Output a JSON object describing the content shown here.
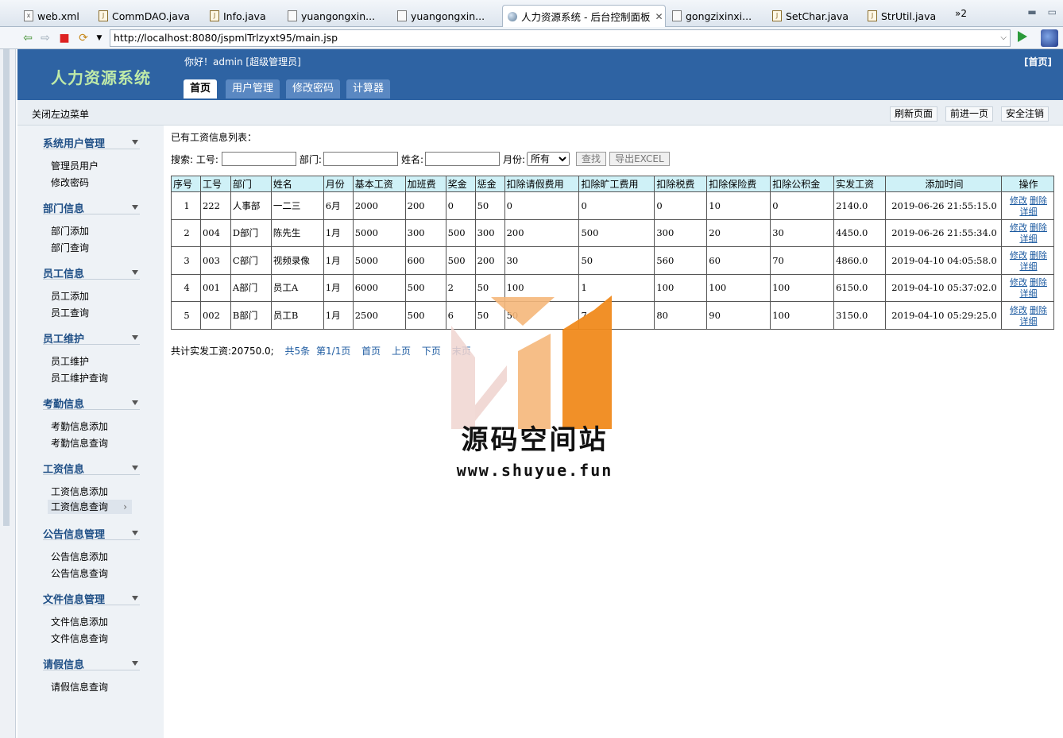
{
  "editor_tabs": [
    {
      "label": "web.xml",
      "icon": "xml-file-icon"
    },
    {
      "label": "CommDAO.java",
      "icon": "java-file-icon"
    },
    {
      "label": "Info.java",
      "icon": "java-file-icon"
    },
    {
      "label": "yuangongxin...",
      "icon": "file-icon"
    },
    {
      "label": "yuangongxin...",
      "icon": "file-icon"
    },
    {
      "label": "人力资源系统 - 后台控制面板",
      "icon": "globe-icon",
      "active": true
    },
    {
      "label": "gongzixinxi...",
      "icon": "file-icon"
    },
    {
      "label": "SetChar.java",
      "icon": "java-file-icon"
    },
    {
      "label": "StrUtil.java",
      "icon": "java-file-icon"
    }
  ],
  "tabs_overflow": "»2",
  "browser": {
    "url": "http://localhost:8080/jspmlTrlzyxt95/main.jsp"
  },
  "app": {
    "title": "人力资源系统",
    "greeting": "你好！admin [超级管理员]",
    "home_link": "[首页]",
    "main_tabs": [
      "首页",
      "用户管理",
      "修改密码",
      "计算器"
    ],
    "close_left_menu": "关闭左边菜单",
    "sub_buttons": [
      "刷新页面",
      "前进一页",
      "安全注销"
    ]
  },
  "sidebar": [
    {
      "title": "系统用户管理",
      "items": [
        "管理员用户",
        "修改密码"
      ]
    },
    {
      "title": "部门信息",
      "items": [
        "部门添加",
        "部门查询"
      ]
    },
    {
      "title": "员工信息",
      "items": [
        "员工添加",
        "员工查询"
      ]
    },
    {
      "title": "员工维护",
      "items": [
        "员工维护",
        "员工维护查询"
      ]
    },
    {
      "title": "考勤信息",
      "items": [
        "考勤信息添加",
        "考勤信息查询"
      ]
    },
    {
      "title": "工资信息",
      "items": [
        "工资信息添加",
        "工资信息查询"
      ]
    },
    {
      "title": "公告信息管理",
      "items": [
        "公告信息添加",
        "公告信息查询"
      ]
    },
    {
      "title": "文件信息管理",
      "items": [
        "文件信息添加",
        "文件信息查询"
      ]
    },
    {
      "title": "请假信息",
      "items": [
        "请假信息查询"
      ]
    }
  ],
  "sidebar_active": "工资信息查询",
  "content": {
    "list_title": "已有工资信息列表：",
    "search": {
      "label_prefix": "搜索: 工号:",
      "dept_label": "部门:",
      "name_label": "姓名:",
      "month_label": "月份:",
      "month_selected": "所有",
      "search_btn": "查找",
      "export_btn": "导出EXCEL"
    },
    "columns": [
      "序号",
      "工号",
      "部门",
      "姓名",
      "月份",
      "基本工资",
      "加班费",
      "奖金",
      "惩金",
      "扣除请假费用",
      "扣除旷工费用",
      "扣除税费",
      "扣除保险费",
      "扣除公积金",
      "实发工资",
      "添加时间",
      "操作"
    ],
    "rows": [
      [
        "1",
        "222",
        "人事部",
        "一二三",
        "6月",
        "2000",
        "200",
        "0",
        "50",
        "0",
        "0",
        "0",
        "10",
        "0",
        "2140.0",
        "2019-06-26 21:55:15.0"
      ],
      [
        "2",
        "004",
        "D部门",
        "陈先生",
        "1月",
        "5000",
        "300",
        "500",
        "300",
        "200",
        "500",
        "300",
        "20",
        "30",
        "4450.0",
        "2019-06-26 21:55:34.0"
      ],
      [
        "3",
        "003",
        "C部门",
        "视频录像",
        "1月",
        "5000",
        "600",
        "500",
        "200",
        "30",
        "50",
        "560",
        "60",
        "70",
        "4860.0",
        "2019-04-10 04:05:58.0"
      ],
      [
        "4",
        "001",
        "A部门",
        "员工A",
        "1月",
        "6000",
        "500",
        "2",
        "50",
        "100",
        "1",
        "100",
        "100",
        "100",
        "6150.0",
        "2019-04-10 05:37:02.0"
      ],
      [
        "5",
        "002",
        "B部门",
        "员工B",
        "1月",
        "2500",
        "500",
        "6",
        "50",
        "50",
        "7",
        "80",
        "90",
        "100",
        "3150.0",
        "2019-04-10 05:29:25.0"
      ]
    ],
    "row_actions": [
      "修改",
      "删除",
      "详细"
    ],
    "footer": {
      "total": "共计实发工资:20750.0;",
      "count": "共5条",
      "page": "第1/1页",
      "first": "首页",
      "prev": "上页",
      "next": "下页",
      "last": "末页"
    }
  },
  "watermark": {
    "title": "源码空间站",
    "url": "www.shuyue.fun",
    "colors": [
      "#f08a1c",
      "#f5b77a",
      "#f0d5d0"
    ]
  },
  "colors": {
    "header": "#2e63a3",
    "logo_text": "#bfeaa8",
    "table_header": "#cff1f7",
    "link": "#1c5aa0"
  }
}
